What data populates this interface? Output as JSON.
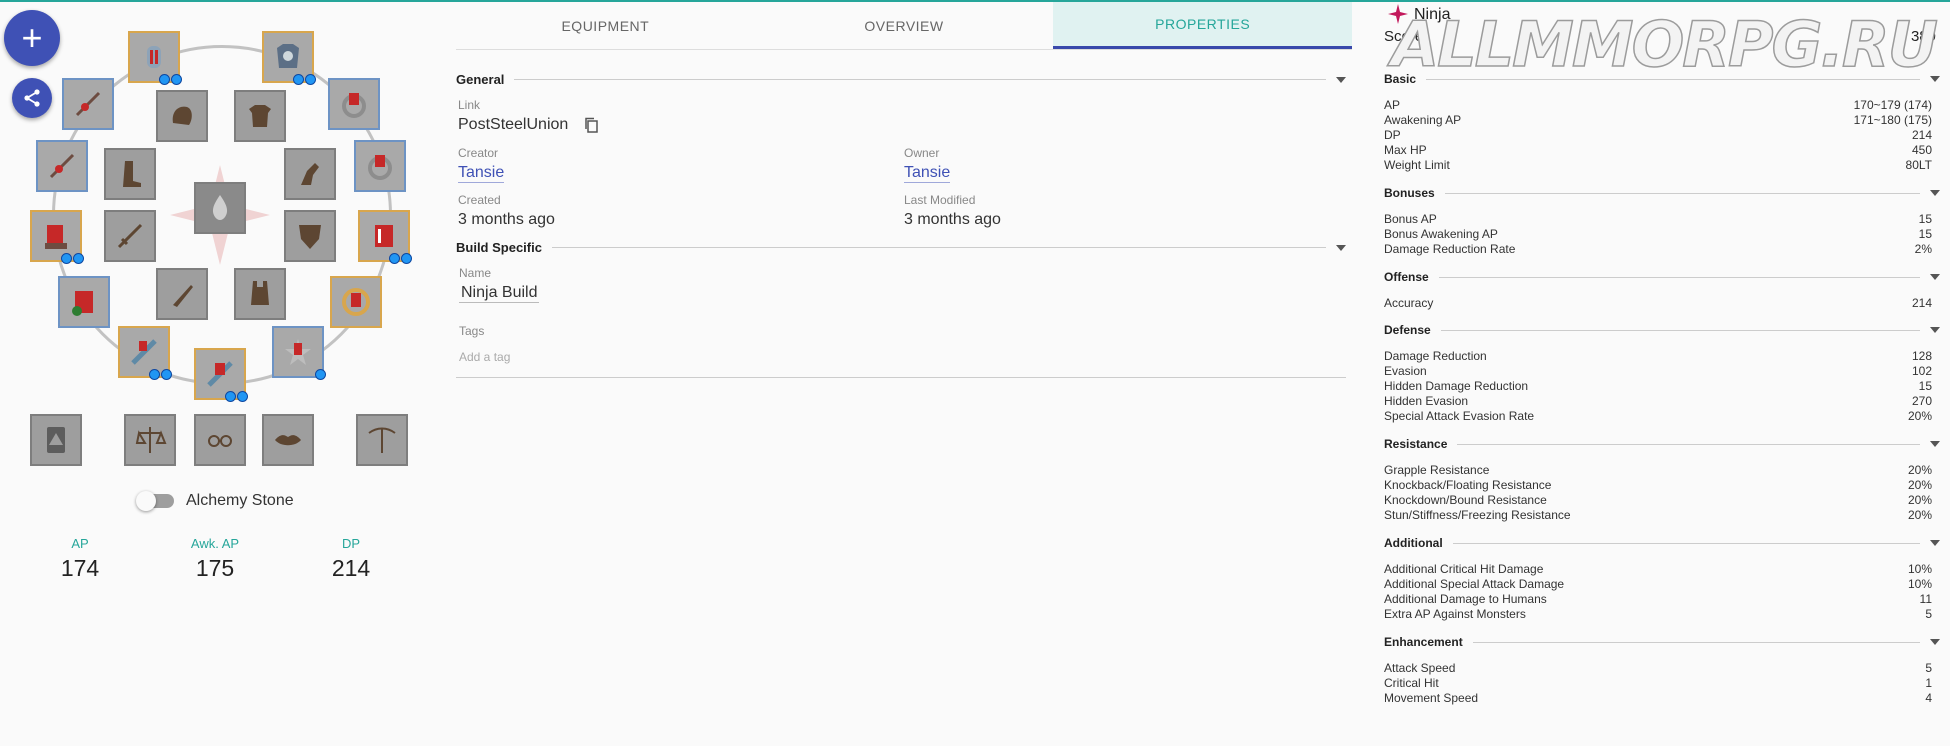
{
  "fab": {
    "add_symbol": "+"
  },
  "gear": {
    "alchemy_label": "Alchemy Stone",
    "stats": [
      {
        "label": "AP",
        "value": "174"
      },
      {
        "label": "Awk. AP",
        "value": "175"
      },
      {
        "label": "DP",
        "value": "214"
      }
    ]
  },
  "tabs": [
    {
      "label": "EQUIPMENT"
    },
    {
      "label": "OVERVIEW"
    },
    {
      "label": "PROPERTIES"
    }
  ],
  "general": {
    "title": "General",
    "link_label": "Link",
    "link_value": "PostSteelUnion",
    "creator_label": "Creator",
    "creator_value": "Tansie",
    "owner_label": "Owner",
    "owner_value": "Tansie",
    "created_label": "Created",
    "created_value": "3 months ago",
    "modified_label": "Last Modified",
    "modified_value": "3 months ago"
  },
  "build": {
    "title": "Build Specific",
    "name_label": "Name",
    "name_value": "Ninja Build",
    "tags_label": "Tags",
    "tags_placeholder": "Add a tag"
  },
  "summary": {
    "class_name": "Ninja",
    "score_label": "Score:",
    "score_value": "389",
    "watermark": "ALLMMORPG.RU"
  },
  "stat_sections": [
    {
      "title": "Basic",
      "rows": [
        {
          "k": "AP",
          "v": "170~179 (174)"
        },
        {
          "k": "Awakening AP",
          "v": "171~180 (175)"
        },
        {
          "k": "DP",
          "v": "214"
        },
        {
          "k": "Max HP",
          "v": "450"
        },
        {
          "k": "Weight Limit",
          "v": "80LT"
        }
      ]
    },
    {
      "title": "Bonuses",
      "rows": [
        {
          "k": "Bonus AP",
          "v": "15"
        },
        {
          "k": "Bonus Awakening AP",
          "v": "15"
        },
        {
          "k": "Damage Reduction Rate",
          "v": "2%"
        }
      ]
    },
    {
      "title": "Offense",
      "rows": [
        {
          "k": "Accuracy",
          "v": "214"
        }
      ]
    },
    {
      "title": "Defense",
      "rows": [
        {
          "k": "Damage Reduction",
          "v": "128"
        },
        {
          "k": "Evasion",
          "v": "102"
        },
        {
          "k": "Hidden Damage Reduction",
          "v": "15"
        },
        {
          "k": "Hidden Evasion",
          "v": "270"
        },
        {
          "k": "Special Attack Evasion Rate",
          "v": "20%"
        }
      ]
    },
    {
      "title": "Resistance",
      "rows": [
        {
          "k": "Grapple Resistance",
          "v": "20%"
        },
        {
          "k": "Knockback/Floating Resistance",
          "v": "20%"
        },
        {
          "k": "Knockdown/Bound Resistance",
          "v": "20%"
        },
        {
          "k": "Stun/Stiffness/Freezing Resistance",
          "v": "20%"
        }
      ]
    },
    {
      "title": "Additional",
      "rows": [
        {
          "k": "Additional Critical Hit Damage",
          "v": "10%"
        },
        {
          "k": "Additional Special Attack Damage",
          "v": "10%"
        },
        {
          "k": "Additional Damage to Humans",
          "v": "11"
        },
        {
          "k": "Extra AP Against Monsters",
          "v": "5"
        }
      ]
    },
    {
      "title": "Enhancement",
      "rows": [
        {
          "k": "Attack Speed",
          "v": "5"
        },
        {
          "k": "Critical Hit",
          "v": "1"
        },
        {
          "k": "Movement Speed",
          "v": "4"
        }
      ]
    }
  ],
  "colors": {
    "accent": "#26a69a",
    "primary": "#3f51b5",
    "link": "#3f51b5"
  }
}
